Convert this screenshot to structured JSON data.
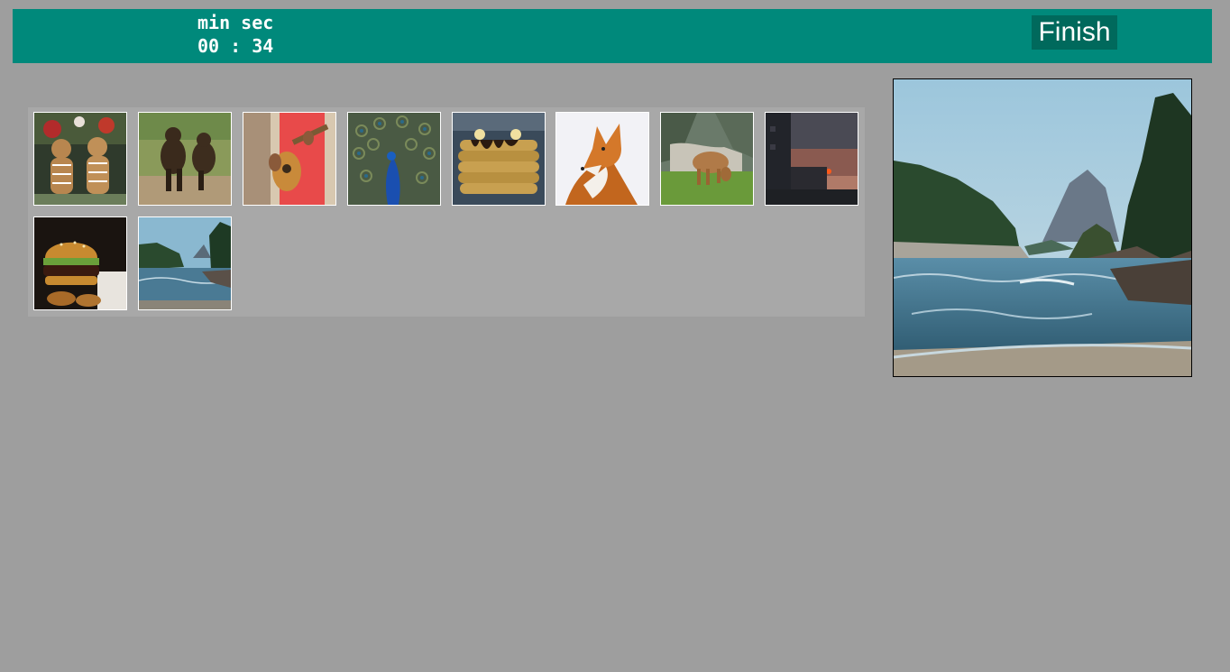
{
  "header": {
    "timer_units": "min sec",
    "timer_value": "00 : 34",
    "finish_label": "Finish"
  },
  "gallery": {
    "items": [
      {
        "icon": "gingerbread-cookies-image"
      },
      {
        "icon": "monkeys-image"
      },
      {
        "icon": "guitar-player-image"
      },
      {
        "icon": "peacock-image"
      },
      {
        "icon": "pancakes-image"
      },
      {
        "icon": "fox-image"
      },
      {
        "icon": "cow-grazing-image"
      },
      {
        "icon": "sunset-building-image"
      },
      {
        "icon": "burger-image"
      },
      {
        "icon": "coastline-image"
      }
    ]
  },
  "preview": {
    "icon": "coastline-preview-image"
  },
  "colors": {
    "background": "#9e9e9e",
    "header_bar": "#00897b",
    "finish_button": "#00695c",
    "gallery_panel": "#a8a8a8"
  }
}
